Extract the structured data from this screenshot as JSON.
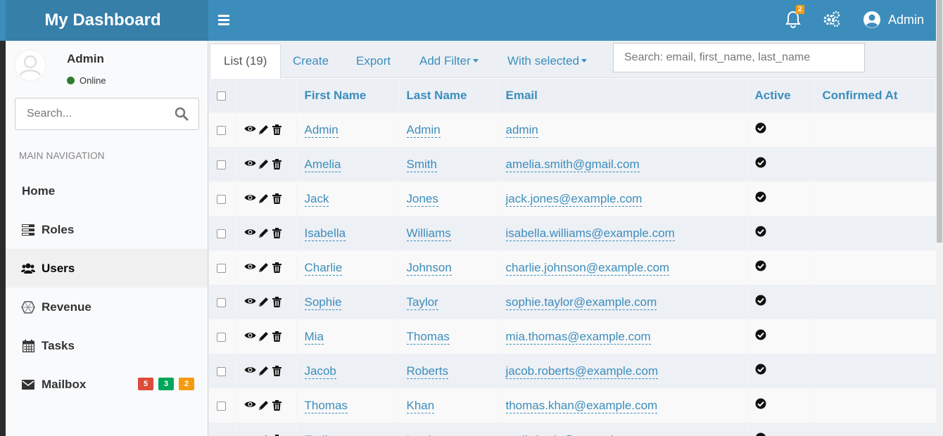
{
  "header": {
    "app_title": "My Dashboard",
    "notifications_count": "2",
    "user_name": "Admin"
  },
  "sidebar": {
    "user": {
      "name": "Admin",
      "status": "Online"
    },
    "search_placeholder": "Search...",
    "nav_header": "MAIN NAVIGATION",
    "items": [
      {
        "label": "Home",
        "icon": "none"
      },
      {
        "label": "Roles",
        "icon": "server-icon"
      },
      {
        "label": "Users",
        "icon": "users-icon",
        "active": true
      },
      {
        "label": "Revenue",
        "icon": "cube-icon"
      },
      {
        "label": "Tasks",
        "icon": "calendar-icon"
      },
      {
        "label": "Mailbox",
        "icon": "envelope-icon",
        "badges": [
          "5",
          "3",
          "2"
        ]
      }
    ],
    "mailbox_badge_colors": [
      "#dd4b39",
      "#00a65a",
      "#f39c12"
    ]
  },
  "tabs": {
    "list": "List (19)",
    "create": "Create",
    "export": "Export",
    "add_filter": "Add Filter",
    "with_selected": "With selected"
  },
  "filter_placeholder": "Search: email, first_name, last_name",
  "table": {
    "columns": [
      "First Name",
      "Last Name",
      "Email",
      "Active",
      "Confirmed At"
    ],
    "rows": [
      {
        "first": "Admin",
        "last": "Admin",
        "email": "admin"
      },
      {
        "first": "Amelia",
        "last": "Smith",
        "email": "amelia.smith@gmail.com"
      },
      {
        "first": "Jack",
        "last": "Jones",
        "email": "jack.jones@example.com"
      },
      {
        "first": "Isabella",
        "last": "Williams",
        "email": "isabella.williams@example.com"
      },
      {
        "first": "Charlie",
        "last": "Johnson",
        "email": "charlie.johnson@example.com"
      },
      {
        "first": "Sophie",
        "last": "Taylor",
        "email": "sophie.taylor@example.com"
      },
      {
        "first": "Mia",
        "last": "Thomas",
        "email": "mia.thomas@example.com"
      },
      {
        "first": "Jacob",
        "last": "Roberts",
        "email": "jacob.roberts@example.com"
      },
      {
        "first": "Thomas",
        "last": "Khan",
        "email": "thomas.khan@example.com"
      },
      {
        "first": "Emily",
        "last": "Lewis",
        "email": "emily.lewis@example.com"
      }
    ]
  },
  "colors": {
    "header": "#3c8dbc",
    "logo": "#367fa9",
    "link": "#3c8dbc"
  }
}
